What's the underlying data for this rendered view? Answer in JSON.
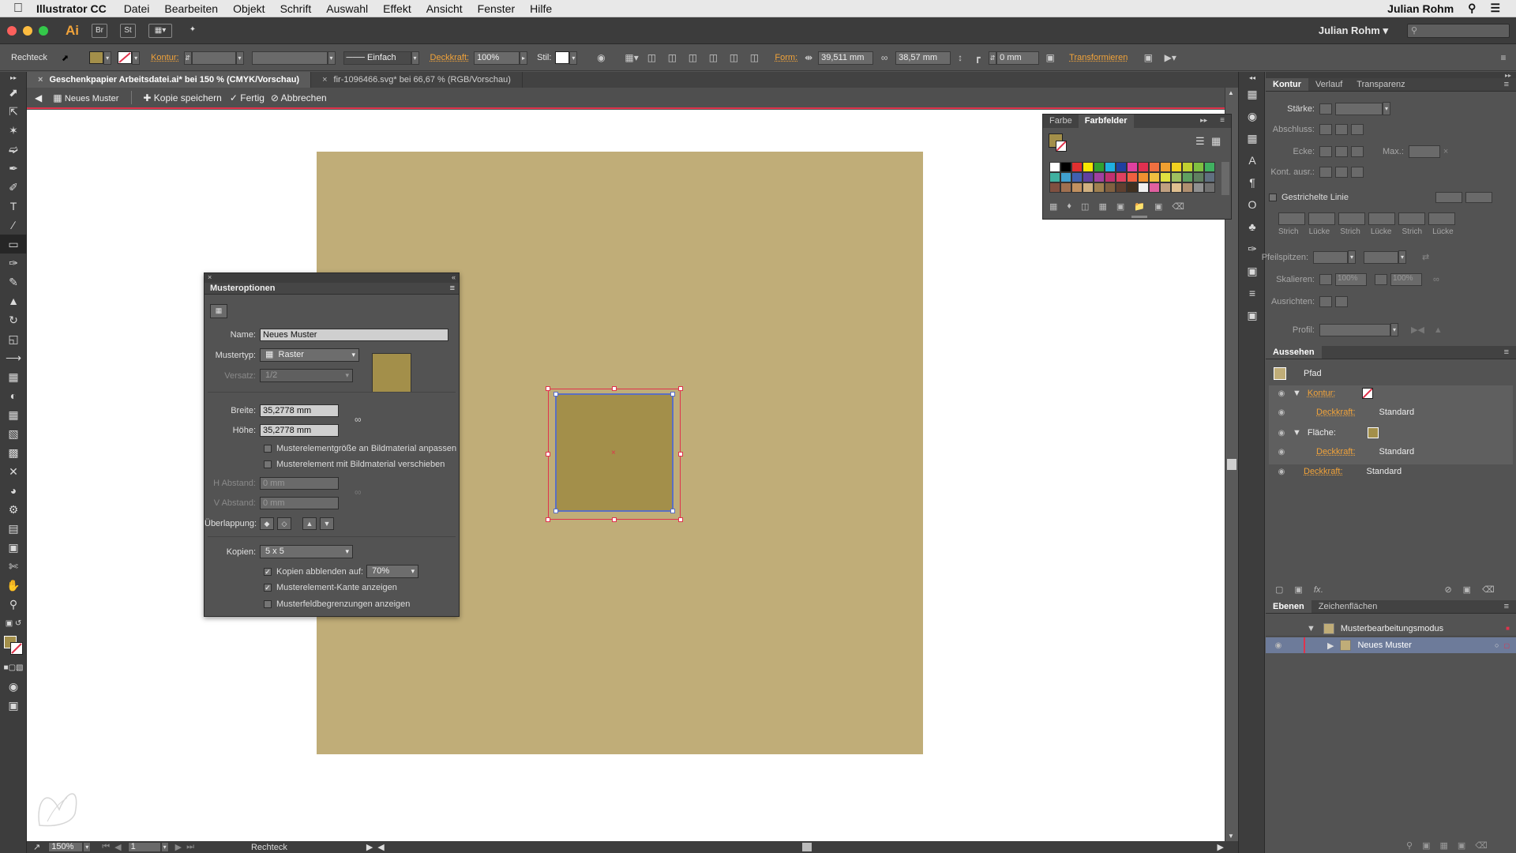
{
  "menubar": {
    "app": "Illustrator CC",
    "items": [
      "Datei",
      "Bearbeiten",
      "Objekt",
      "Schrift",
      "Auswahl",
      "Effekt",
      "Ansicht",
      "Fenster",
      "Hilfe"
    ],
    "user": "Julian Rohm"
  },
  "appbar": {
    "logo": "Ai",
    "bridge": "Br",
    "stock": "St",
    "user": "Julian Rohm"
  },
  "controlbar": {
    "object": "Rechteck",
    "kontur_label": "Kontur:",
    "stroke_style": "Einfach",
    "deckkraft_label": "Deckkraft:",
    "deckkraft_value": "100%",
    "stil_label": "Stil:",
    "form_label": "Form:",
    "width": "39,511 mm",
    "height": "38,57 mm",
    "corner": "0 mm",
    "transform": "Transformieren"
  },
  "doctabs": [
    "Geschenkpapier Arbeitsdatei.ai* bei 150 % (CMYK/Vorschau)",
    "fir-1096466.svg* bei 66,67 % (RGB/Vorschau)"
  ],
  "patternbar": {
    "name": "Neues Muster",
    "save_copy": "Kopie speichern",
    "done": "Fertig",
    "cancel": "Abbrechen"
  },
  "pattern_options": {
    "title": "Musteroptionen",
    "name_label": "Name:",
    "name_value": "Neues Muster",
    "type_label": "Mustertyp:",
    "type_value": "Raster",
    "offset_label": "Versatz:",
    "offset_value": "1/2",
    "width_label": "Breite:",
    "width_value": "35,2778 mm",
    "height_label": "Höhe:",
    "height_value": "35,2778 mm",
    "chk_fit": "Musterelementgröße an Bildmaterial anpassen",
    "chk_move": "Musterelement mit Bildmaterial verschieben",
    "h_spacing_label": "H Abstand:",
    "h_spacing_value": "0 mm",
    "v_spacing_label": "V Abstand:",
    "v_spacing_value": "0 mm",
    "overlap_label": "Überlappung:",
    "copies_label": "Kopien:",
    "copies_value": "5 x 5",
    "dim_label": "Kopien abblenden auf:",
    "dim_value": "70%",
    "chk_edge": "Musterelement-Kante anzeigen",
    "chk_bounds": "Musterfeldbegrenzungen anzeigen",
    "swatch_color": "#a38f4a"
  },
  "swatches_panel": {
    "tab_color": "Farbe",
    "tab_swatches": "Farbfelder"
  },
  "stroke_panel": {
    "tabs": [
      "Kontur",
      "Verlauf",
      "Transparenz"
    ],
    "weight_label": "Stärke:",
    "cap_label": "Abschluss:",
    "corner_label": "Ecke:",
    "limit_label": "Max.:",
    "align_label": "Kont. ausr.:",
    "dashed_label": "Gestrichelte Linie",
    "dash_cols": [
      "Strich",
      "Lücke",
      "Strich",
      "Lücke",
      "Strich",
      "Lücke"
    ],
    "arrow_label": "Pfeilspitzen:",
    "scale_label": "Skalieren:",
    "scale_value_1": "100%",
    "scale_value_2": "100%",
    "arrange_label": "Ausrichten:",
    "profile_label": "Profil:"
  },
  "appearance_panel": {
    "tab": "Aussehen",
    "path": "Pfad",
    "kontur": "Kontur:",
    "deckkraft": "Deckkraft:",
    "standard": "Standard",
    "flaeche": "Fläche:"
  },
  "layers_panel": {
    "tabs": [
      "Ebenen",
      "Zeichenflächen"
    ],
    "layer_1": "Musterbearbeitungsmodus",
    "layer_2": "Neues Muster"
  },
  "statusbar": {
    "zoom": "150%",
    "page": "1",
    "tool": "Rechteck"
  }
}
